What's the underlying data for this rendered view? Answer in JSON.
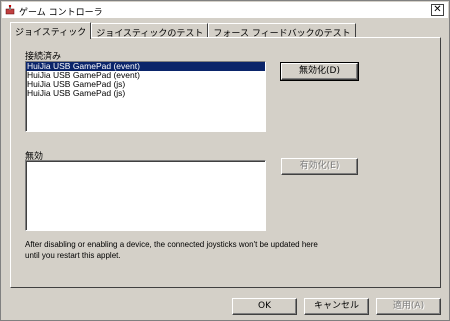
{
  "window": {
    "title": "ゲーム コントローラ"
  },
  "tabs": [
    {
      "label": "ジョイスティック"
    },
    {
      "label": "ジョイスティックのテスト"
    },
    {
      "label": "フォース フィードバックのテスト"
    }
  ],
  "connected": {
    "label": "接続済み",
    "items": [
      "HuiJia  USB GamePad (event)",
      "HuiJia  USB GamePad (event)",
      "HuiJia  USB GamePad (js)",
      "HuiJia  USB GamePad (js)"
    ],
    "selected_index": 0,
    "disable_label": "無効化(D)"
  },
  "disabled": {
    "label": "無効",
    "enable_label": "有効化(E)"
  },
  "info_text": "After disabling or enabling a device, the connected joysticks won't be updated here until you restart this applet.",
  "footer": {
    "ok_label": "OK",
    "cancel_label": "キャンセル",
    "apply_label": "適用(A)"
  },
  "colors": {
    "selection": "#0a246a",
    "face": "#d4d0c8"
  }
}
